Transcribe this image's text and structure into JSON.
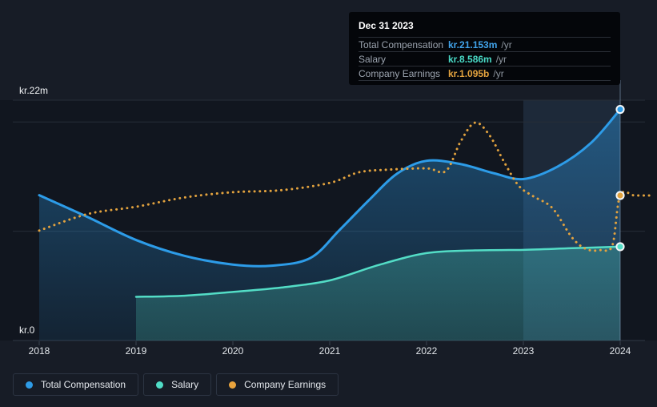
{
  "tooltip": {
    "date": "Dec 31 2023",
    "rows": [
      {
        "label": "Total Compensation",
        "value": "kr.21.153m",
        "suffix": "/yr",
        "color": "#41A3EA"
      },
      {
        "label": "Salary",
        "value": "kr.8.586m",
        "suffix": "/yr",
        "color": "#49D9C5"
      },
      {
        "label": "Company Earnings",
        "value": "kr.1.095b",
        "suffix": "/yr",
        "color": "#E3A33F"
      }
    ]
  },
  "legend": [
    {
      "label": "Total Compensation",
      "color": "#2E9BE6"
    },
    {
      "label": "Salary",
      "color": "#50DCC6"
    },
    {
      "label": "Company Earnings",
      "color": "#E8A33D"
    }
  ],
  "chart_data": {
    "type": "line",
    "x_ticks": [
      "2018",
      "2019",
      "2020",
      "2021",
      "2022",
      "2023",
      "2024"
    ],
    "xlim": [
      2018,
      2024.35
    ],
    "y_axis": {
      "top_label": "kr.22m",
      "zero_label": "kr.0",
      "max_m": 22,
      "gridlines_m": [
        22,
        20,
        10,
        0
      ]
    },
    "earnings_axis_max_b": 1.815,
    "highlight_band": {
      "x_start": 2023,
      "x_end": 2024
    },
    "hover_x": 2024,
    "grid": "horizontal-only",
    "legend_position": "bottom-left",
    "series": [
      {
        "name": "Total Compensation",
        "unit": "kr_millions_per_yr",
        "color": "#2D9CE8",
        "style": "solid",
        "area": true,
        "end_marker": true,
        "x": [
          2018,
          2018.5,
          2019,
          2019.5,
          2020,
          2020.4,
          2020.8,
          2021.1,
          2021.4,
          2021.7,
          2022,
          2022.35,
          2022.7,
          2023,
          2023.35,
          2023.7,
          2024
        ],
        "values": [
          13.3,
          11.3,
          9.2,
          7.75,
          6.95,
          6.85,
          7.55,
          10.1,
          12.8,
          15.3,
          16.45,
          16.15,
          15.3,
          14.78,
          15.9,
          18.1,
          21.153
        ]
      },
      {
        "name": "Salary",
        "unit": "kr_millions_per_yr",
        "color": "#53DDC6",
        "style": "solid",
        "area": true,
        "end_marker": true,
        "x": [
          2019,
          2019.5,
          2020,
          2020.5,
          2021,
          2021.5,
          2022,
          2022.5,
          2023,
          2023.5,
          2024
        ],
        "values": [
          4.0,
          4.1,
          4.45,
          4.85,
          5.5,
          6.9,
          8.0,
          8.25,
          8.3,
          8.45,
          8.586
        ]
      },
      {
        "name": "Company Earnings",
        "unit": "kr_billions_per_yr",
        "color": "#E2A23E",
        "style": "dotted",
        "area": false,
        "end_marker": true,
        "marker_x": 2024,
        "x": [
          2018,
          2018.5,
          2019,
          2019.5,
          2020,
          2020.5,
          2021,
          2021.3,
          2021.6,
          2022,
          2022.2,
          2022.35,
          2022.5,
          2022.65,
          2022.8,
          2022.95,
          2023.1,
          2023.3,
          2023.5,
          2023.65,
          2023.8,
          2023.92,
          2024,
          2024.15,
          2024.3
        ],
        "values": [
          0.83,
          0.955,
          1.01,
          1.08,
          1.12,
          1.135,
          1.19,
          1.27,
          1.29,
          1.3,
          1.28,
          1.5,
          1.645,
          1.55,
          1.35,
          1.17,
          1.09,
          1.0,
          0.78,
          0.69,
          0.683,
          0.72,
          1.095,
          1.095,
          1.095
        ]
      }
    ]
  }
}
